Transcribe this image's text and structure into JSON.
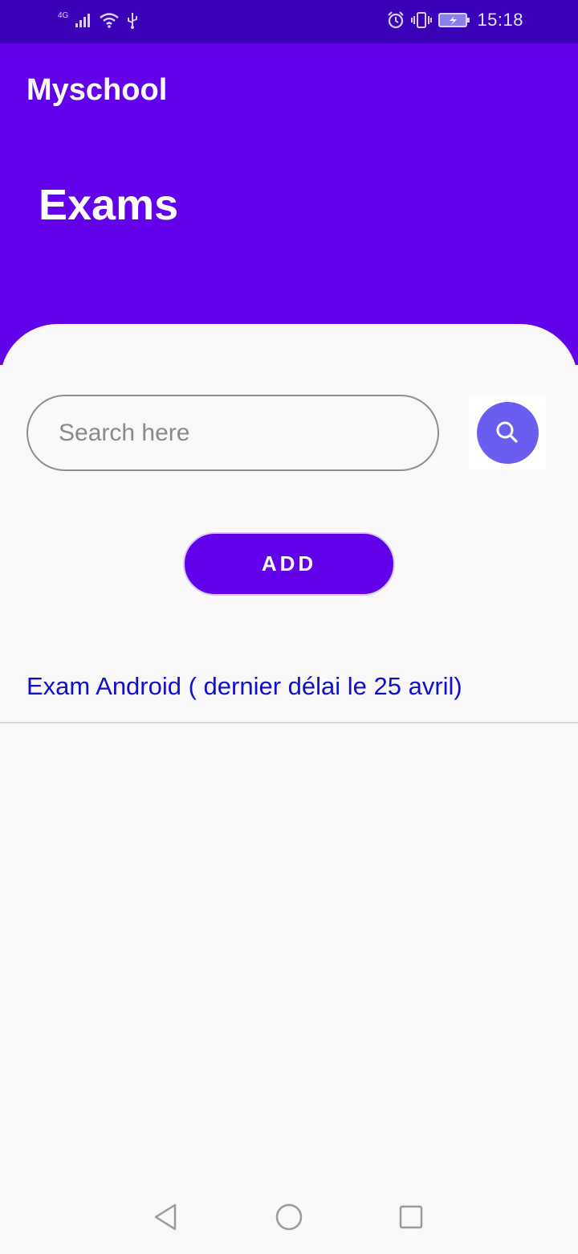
{
  "status_bar": {
    "network": "4G",
    "time": "15:18",
    "icons": [
      "signal-icon",
      "wifi-icon",
      "usb-icon",
      "alarm-icon",
      "vibrate-icon",
      "battery-charging-icon"
    ]
  },
  "app": {
    "title": "Myschool",
    "screen_title": "Exams",
    "accent_color": "#6200ea",
    "status_bar_color": "#3a00b7"
  },
  "search": {
    "placeholder": "Search here",
    "value": "",
    "button_icon": "search-icon",
    "button_color": "#6a5ef0"
  },
  "actions": {
    "add_label": "ADD"
  },
  "exams": [
    {
      "label": "Exam Android ( dernier délai le 25 avril)"
    }
  ],
  "nav": {
    "icons": [
      "back-icon",
      "home-icon",
      "recents-icon"
    ]
  }
}
